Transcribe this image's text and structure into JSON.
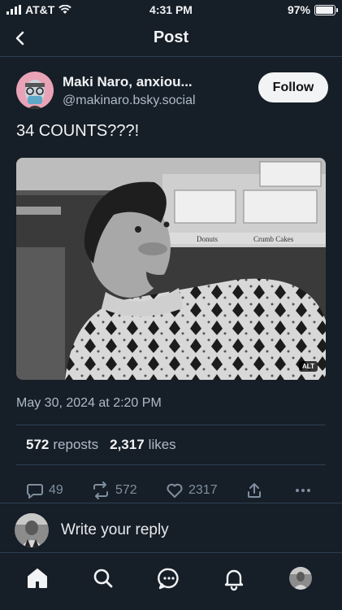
{
  "status_bar": {
    "carrier": "AT&T",
    "time": "4:31 PM",
    "battery": "97%",
    "battery_level": 0.97
  },
  "header": {
    "title": "Post",
    "back_icon": "chevron-left-icon"
  },
  "post": {
    "author_name": "Maki Naro, anxiou...",
    "author_handle": "@makinaro.bsky.social",
    "follow_label": "Follow",
    "text": "34 COUNTS???!",
    "image_alt_badge": "ALT",
    "image_description_visible_text": [
      "Donuts",
      "Crumb Cakes"
    ],
    "timestamp": "May 30, 2024 at 2:20 PM",
    "reposts_count": "572",
    "reposts_label": "reposts",
    "likes_count": "2,317",
    "likes_label": "likes"
  },
  "actions": {
    "replies": "49",
    "reposts": "572",
    "likes": "2317"
  },
  "reply": {
    "placeholder": "Write your reply"
  },
  "tabs": [
    "home-icon",
    "search-icon",
    "chat-icon",
    "bell-icon",
    "profile-avatar"
  ],
  "colors": {
    "background": "#161e27",
    "divider": "#2e4052",
    "muted": "#aebbc9",
    "icon": "#7f8f9f"
  }
}
